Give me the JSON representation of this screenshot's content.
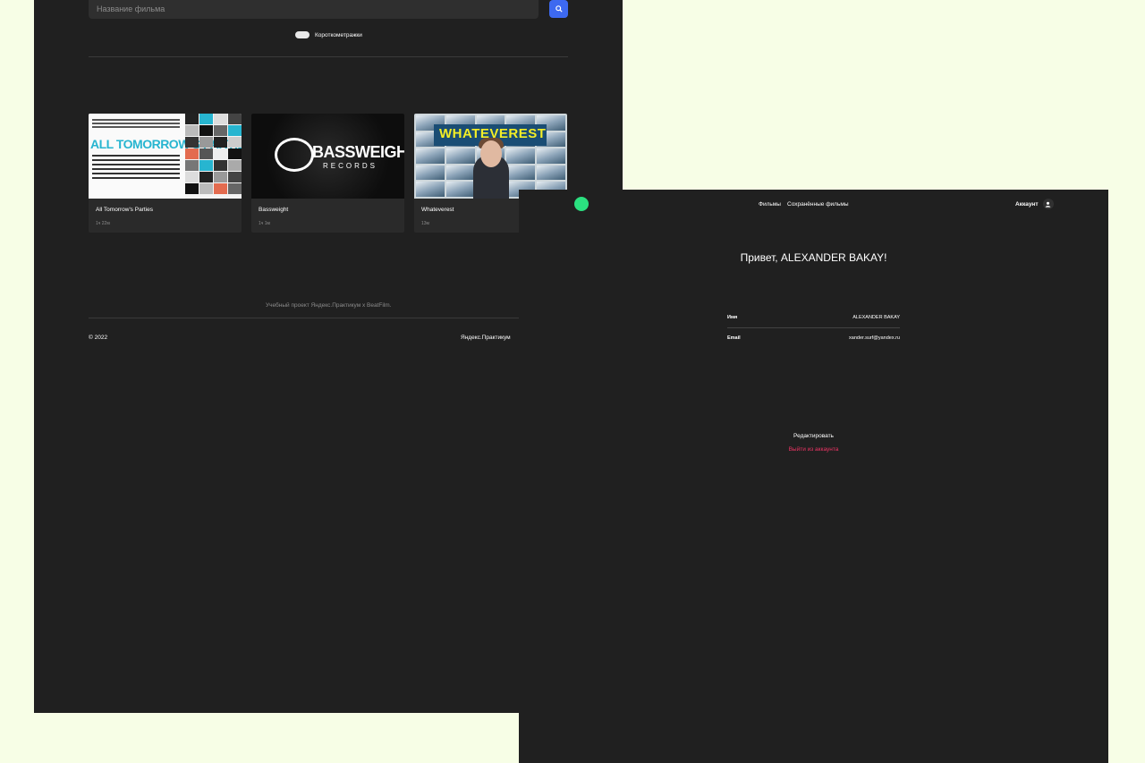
{
  "search": {
    "placeholder": "Название фильма",
    "button_icon": "search-icon",
    "short_films_label": "Короткометражки"
  },
  "movies": [
    {
      "title": "All Tomorrow's Parties",
      "duration": "1ч 22м",
      "poster_text": "ALL TOMORROW'S PARTIES"
    },
    {
      "title": "Bassweight",
      "duration": "1ч 1м",
      "poster_text": "BASSWEIGHT",
      "poster_subtext": "RECORDS"
    },
    {
      "title": "Whateverest",
      "duration": "13м",
      "poster_text": "WHATEVEREST"
    }
  ],
  "footer": {
    "project_text": "Учебный проект Яндекс.Практикум х BeatFilm.",
    "copyright": "© 2022",
    "link": "Яндекс.Практикум"
  },
  "header": {
    "nav_movies": "Фильмы",
    "nav_saved": "Сохранённые фильмы",
    "account": "Аккаунт",
    "account_icon": "user-icon"
  },
  "profile": {
    "greeting": "Привет, ALEXANDER BAKAY!",
    "name_label": "Имя",
    "name_value": "ALEXANDER BAKAY",
    "email_label": "Email",
    "email_value": "xander.surf@yandex.ru",
    "edit_label": "Редактировать",
    "logout_label": "Выйти из аккаунта"
  },
  "colors": {
    "background": "#f7fee6",
    "panel": "#202020",
    "accent_blue": "#3d69f0",
    "logout_red": "#ee3465",
    "cursor_green": "#2be080"
  }
}
